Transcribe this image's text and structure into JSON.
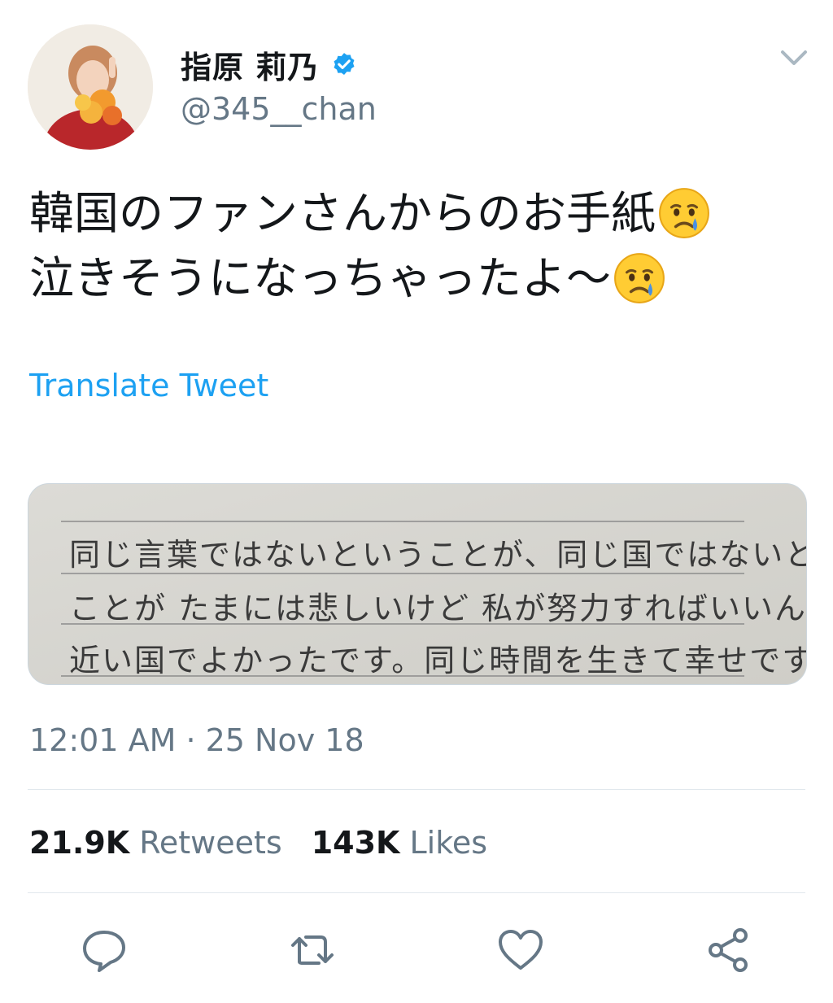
{
  "author": {
    "display_name": "指原 莉乃",
    "handle": "@345__chan",
    "verified": true,
    "verified_color": "#1da1f2"
  },
  "tweet": {
    "lines": [
      "韓国のファンさんからのお手紙",
      "泣きそうになっちゃったよ〜"
    ],
    "emoji": "crying-face",
    "translate_label": "Translate Tweet",
    "timestamp": "12:01 AM · 25 Nov 18"
  },
  "media": {
    "letter_lines": [
      "同じ言葉ではないということが、同じ国ではないという",
      "ことが たまには悲しいけど 私が努力すればいいんですがら。",
      "近い国でよかったです。同じ時間を生きて幸せです。"
    ]
  },
  "stats": {
    "retweets_count": "21.9K",
    "retweets_label": "Retweets",
    "likes_count": "143K",
    "likes_label": "Likes"
  },
  "colors": {
    "accent": "#1da1f2",
    "secondary_text": "#657786",
    "primary_text": "#14171a"
  }
}
